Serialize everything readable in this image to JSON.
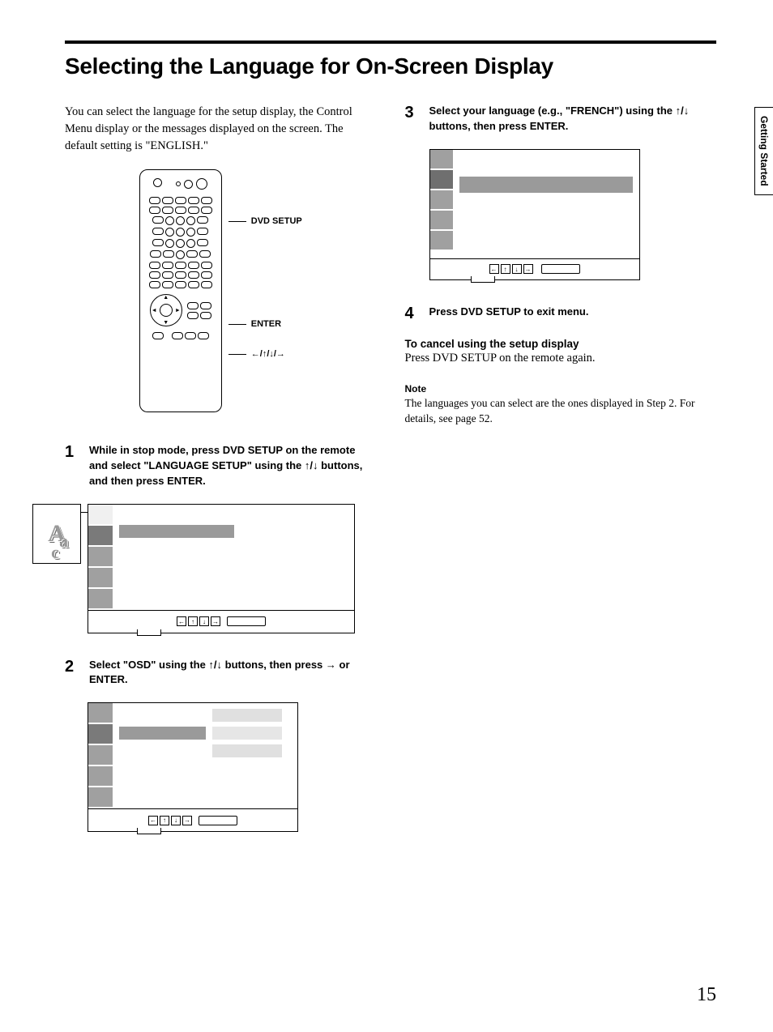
{
  "page": {
    "title": "Selecting the Language for On-Screen Display",
    "intro": "You can select the language for the setup display, the Control Menu display or the messages displayed on the screen.  The default setting is \"ENGLISH.\"",
    "page_number": "15",
    "side_tab": "Getting Started"
  },
  "remote": {
    "label_setup": "DVD SETUP",
    "label_enter": "ENTER",
    "label_arrows": "←/↑/↓/→"
  },
  "steps": {
    "s1": {
      "num": "1",
      "text_a": "While in stop mode, press DVD SETUP on the remote and select \"LANGUAGE SETUP\" using the ",
      "arrows": "↑/↓",
      "text_b": " buttons, and then press ENTER."
    },
    "s2": {
      "num": "2",
      "text_a": "Select \"OSD\" using the ",
      "arrows1": "↑/↓",
      "text_b": " buttons, then press ",
      "arrows2": "→",
      "text_c": " or ENTER."
    },
    "s3": {
      "num": "3",
      "text_a": "Select your language (e.g., \"FRENCH\") using the ",
      "arrows": "↑/↓",
      "text_b": " buttons, then press ENTER."
    },
    "s4": {
      "num": "4",
      "text": "Press DVD SETUP to exit menu."
    }
  },
  "cancel": {
    "head": "To cancel using the setup display",
    "body": "Press DVD SETUP on the remote again."
  },
  "note": {
    "head": "Note",
    "body": "The languages you can select are the ones displayed in Step 2. For details, see page 52."
  }
}
